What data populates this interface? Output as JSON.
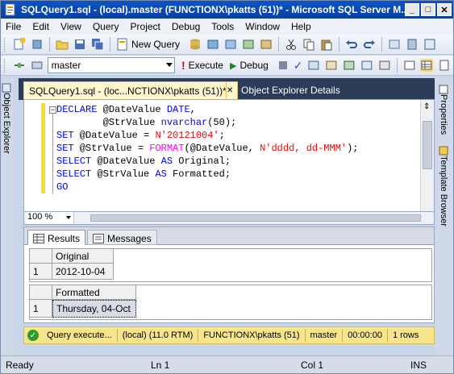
{
  "window": {
    "title": "SQLQuery1.sql - (local).master (FUNCTIONX\\pkatts (51))* - Microsoft SQL Server M...",
    "minimize": "_",
    "maximize": "□",
    "close": "✕"
  },
  "menu": [
    "File",
    "Edit",
    "View",
    "Query",
    "Project",
    "Debug",
    "Tools",
    "Window",
    "Help"
  ],
  "toolbar": {
    "new_query": "New Query",
    "database": "master",
    "execute": "Execute",
    "debug": "Debug"
  },
  "side_left": {
    "object_explorer": "Object Explorer"
  },
  "side_right": {
    "properties": "Properties",
    "template_browser": "Template Browser"
  },
  "tabs": {
    "active": "SQLQuery1.sql - (loc...NCTIONX\\pkatts (51))*",
    "close": "✕",
    "inactive": "Object Explorer Details"
  },
  "editor": {
    "fold": "−",
    "lines": [
      [
        {
          "t": "DECLARE",
          "c": "kw"
        },
        {
          "t": " @DateValue ",
          "c": ""
        },
        {
          "t": "DATE",
          "c": "kw"
        },
        {
          "t": ",",
          "c": ""
        }
      ],
      [
        {
          "t": "        @StrValue ",
          "c": ""
        },
        {
          "t": "nvarchar",
          "c": "kw"
        },
        {
          "t": "(50);",
          "c": ""
        }
      ],
      [
        {
          "t": "SET",
          "c": "kw"
        },
        {
          "t": " @DateValue = ",
          "c": ""
        },
        {
          "t": "N'20121004'",
          "c": "str"
        },
        {
          "t": ";",
          "c": ""
        }
      ],
      [
        {
          "t": "SET",
          "c": "kw"
        },
        {
          "t": " @StrValue = ",
          "c": ""
        },
        {
          "t": "FORMAT",
          "c": "fn"
        },
        {
          "t": "(@DateValue, ",
          "c": ""
        },
        {
          "t": "N'dddd, dd-MMM'",
          "c": "str"
        },
        {
          "t": ");",
          "c": ""
        }
      ],
      [
        {
          "t": "SELECT",
          "c": "kw"
        },
        {
          "t": " @DateValue ",
          "c": ""
        },
        {
          "t": "AS",
          "c": "kw"
        },
        {
          "t": " Original;",
          "c": ""
        }
      ],
      [
        {
          "t": "SELECT",
          "c": "kw"
        },
        {
          "t": " @StrValue ",
          "c": ""
        },
        {
          "t": "AS",
          "c": "kw"
        },
        {
          "t": " Formatted;",
          "c": ""
        }
      ],
      [
        {
          "t": "GO",
          "c": "kw"
        }
      ]
    ]
  },
  "zoom": "100 %",
  "results": {
    "tab_results": "Results",
    "tab_messages": "Messages",
    "grid1": {
      "header": "Original",
      "row_num": "1",
      "value": "2012-10-04"
    },
    "grid2": {
      "header": "Formatted",
      "row_num": "1",
      "value": "Thursday, 04-Oct"
    }
  },
  "query_status": {
    "message": "Query execute...",
    "server": "(local) (11.0 RTM)",
    "user": "FUNCTIONX\\pkatts (51)",
    "database": "master",
    "time": "00:00:00",
    "rows": "1 rows"
  },
  "statusbar": {
    "ready": "Ready",
    "line": "Ln 1",
    "col": "Col 1",
    "mode": "INS"
  },
  "colors": {
    "titlebar": "#0a54c6",
    "keyword": "#0000ff",
    "string": "#ff0000",
    "function": "#ff00ff",
    "query_status_bg": "#f7e58e"
  }
}
